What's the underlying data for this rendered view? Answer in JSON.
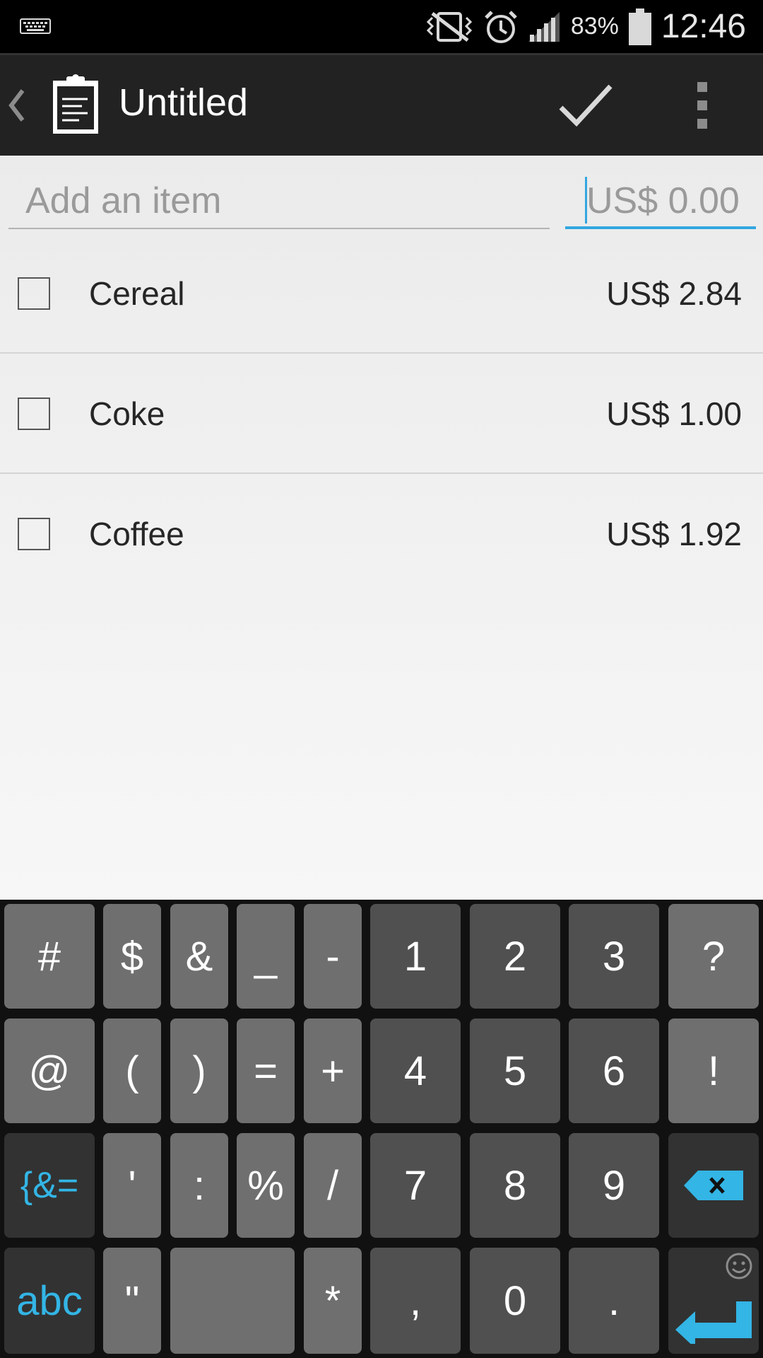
{
  "status_bar": {
    "battery_percent": "83%",
    "time": "12:46",
    "icons": [
      "keyboard-icon",
      "vibrate-off-icon",
      "alarm-icon",
      "signal-icon",
      "battery-icon"
    ]
  },
  "action_bar": {
    "title": "Untitled",
    "icons": [
      "back-chevron-icon",
      "clipboard-list-icon",
      "checkmark-icon",
      "overflow-menu-icon"
    ]
  },
  "input_row": {
    "item_placeholder": "Add an item",
    "price_placeholder": "US$ 0.00"
  },
  "items": [
    {
      "name": "Cereal",
      "price": "US$ 2.84",
      "checked": false
    },
    {
      "name": "Coke",
      "price": "US$ 1.00",
      "checked": false
    },
    {
      "name": "Coffee",
      "price": "US$ 1.92",
      "checked": false
    }
  ],
  "keyboard": {
    "row1": [
      "#",
      "$",
      "&",
      "_",
      "-",
      "1",
      "2",
      "3",
      "?"
    ],
    "row2": [
      "@",
      "(",
      ")",
      "=",
      "+",
      "4",
      "5",
      "6",
      "!"
    ],
    "row3": [
      "{&=",
      "'",
      ":",
      "%",
      "/",
      "7",
      "8",
      "9"
    ],
    "row4": [
      "abc",
      "\"",
      "*",
      ",",
      "0",
      "."
    ],
    "accent_color": "#33b5e5"
  }
}
